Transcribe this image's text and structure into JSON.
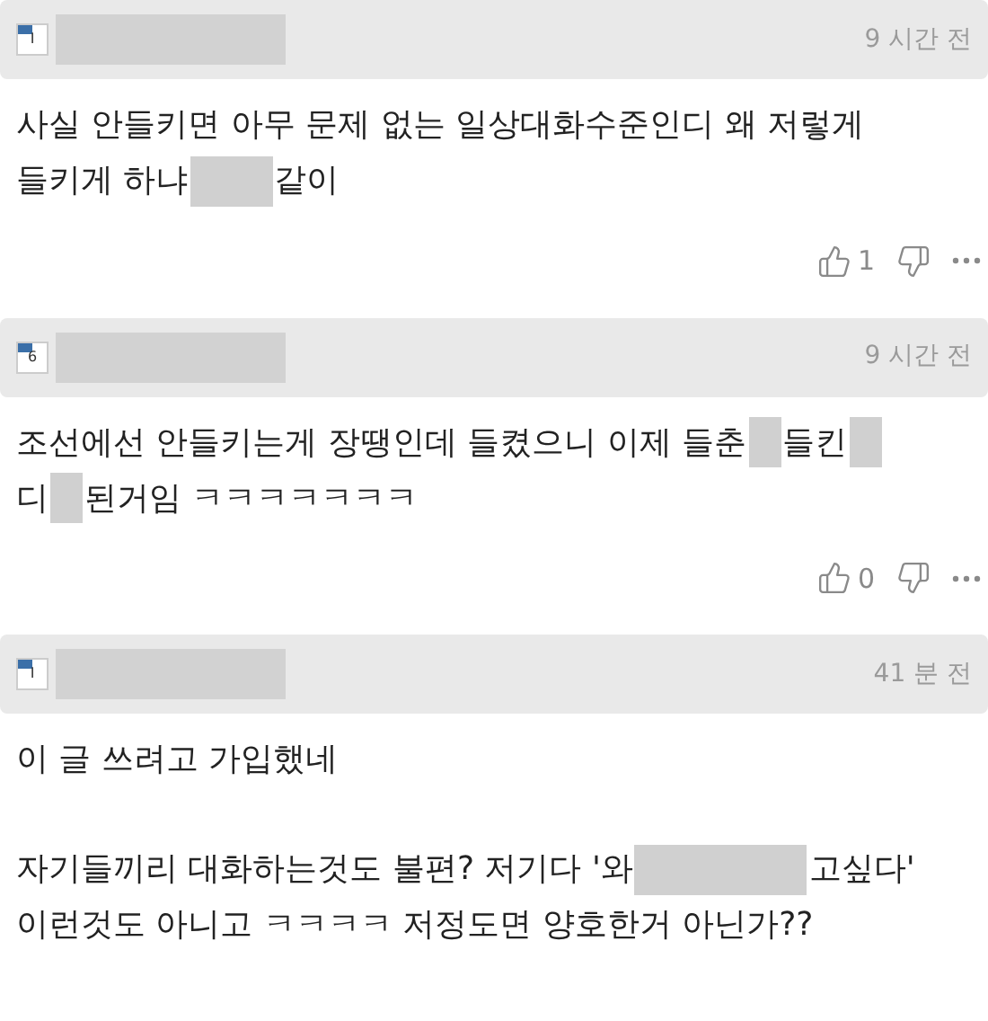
{
  "comments": [
    {
      "avatar_label": "I",
      "time": "9 시간 전",
      "likes": "1",
      "paragraphs": [
        [
          [
            {
              "kind": "text",
              "text": "사실 안들키면 아무 문제 없는 일상대화수준인디 왜 저렇게"
            }
          ],
          [
            {
              "kind": "text",
              "text": "들키게 하냐"
            },
            {
              "kind": "medium"
            },
            {
              "kind": "text",
              "text": "같이"
            }
          ]
        ]
      ]
    },
    {
      "avatar_label": "6",
      "time": "9 시간 전",
      "likes": "0",
      "paragraphs": [
        [
          [
            {
              "kind": "text",
              "text": "조선에선 안들키는게 장땡인데 들켰으니 이제 들춘"
            },
            {
              "kind": "short"
            },
            {
              "kind": "text",
              "text": "들킨"
            },
            {
              "kind": "short"
            }
          ],
          [
            {
              "kind": "text",
              "text": "디"
            },
            {
              "kind": "short"
            },
            {
              "kind": "text",
              "text": "된거임 ㅋㅋㅋㅋㅋㅋㅋ"
            }
          ]
        ]
      ]
    },
    {
      "avatar_label": "I",
      "time": "41 분 전",
      "paragraphs": [
        [
          [
            {
              "kind": "text",
              "text": "이 글 쓰려고 가입했네"
            }
          ]
        ],
        [
          [
            {
              "kind": "text",
              "text": "자기들끼리 대화하는것도 불편? 저기다 '와"
            },
            {
              "kind": "long"
            },
            {
              "kind": "text",
              "text": "고싶다'"
            }
          ],
          [
            {
              "kind": "text",
              "text": "이런것도 아니고 ㅋㅋㅋㅋ 저정도면 양호한거 아닌가??"
            }
          ]
        ]
      ]
    }
  ]
}
